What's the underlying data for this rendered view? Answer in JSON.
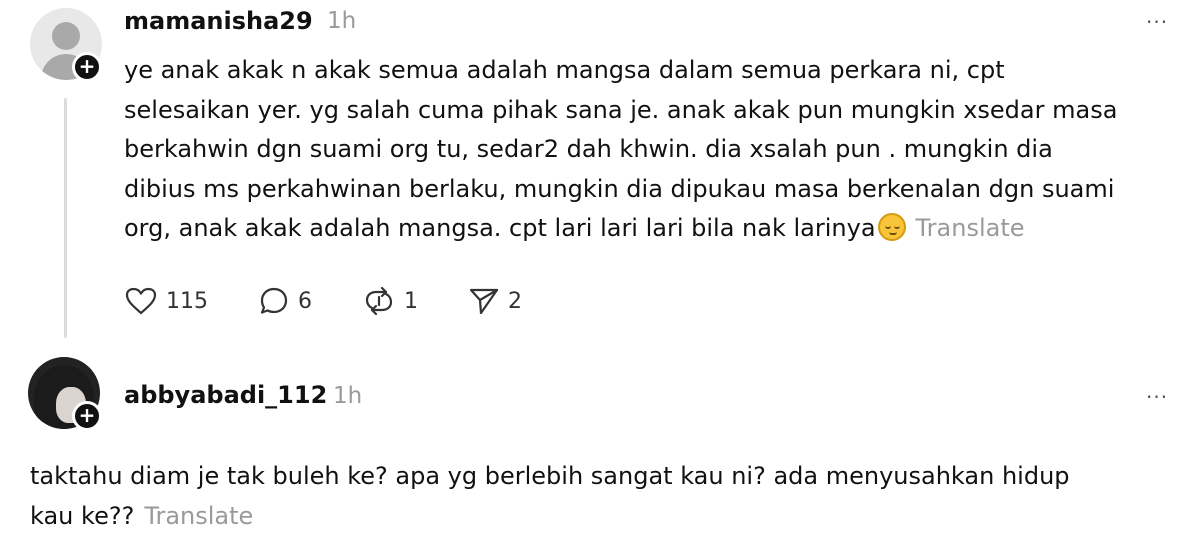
{
  "comments": [
    {
      "username": "mamanisha29",
      "time": "1h",
      "more": "···",
      "text_lines": [
        "ye anak akak n akak semua adalah mangsa dalam semua perkara ni, cpt",
        "selesaikan yer. yg salah cuma pihak sana je. anak akak pun mungkin xsedar masa",
        "berkahwin dgn suami org tu, sedar2 dah khwin. dia xsalah pun . mungkin dia",
        "dibius ms perkahwinan berlaku, mungkin dia dipukau masa berkenalan dgn suami",
        "org, anak akak adalah mangsa. cpt lari lari lari bila nak larinya"
      ],
      "emoji": "pensive-face-emoji",
      "translate": "Translate",
      "actions": {
        "likes": "115",
        "replies": "6",
        "reposts": "1",
        "shares": "2"
      }
    },
    {
      "username": "abbyabadi_112",
      "time": "1h",
      "more": "···",
      "text_lines": [
        "taktahu diam je tak buleh ke? apa yg berlebih sangat kau ni? ada menyusahkan hidup",
        "kau ke??"
      ],
      "translate": "Translate"
    }
  ],
  "icons": {
    "like": "heart-icon",
    "reply": "comment-icon",
    "repost": "repost-icon",
    "share": "send-icon",
    "follow": "plus-icon"
  }
}
